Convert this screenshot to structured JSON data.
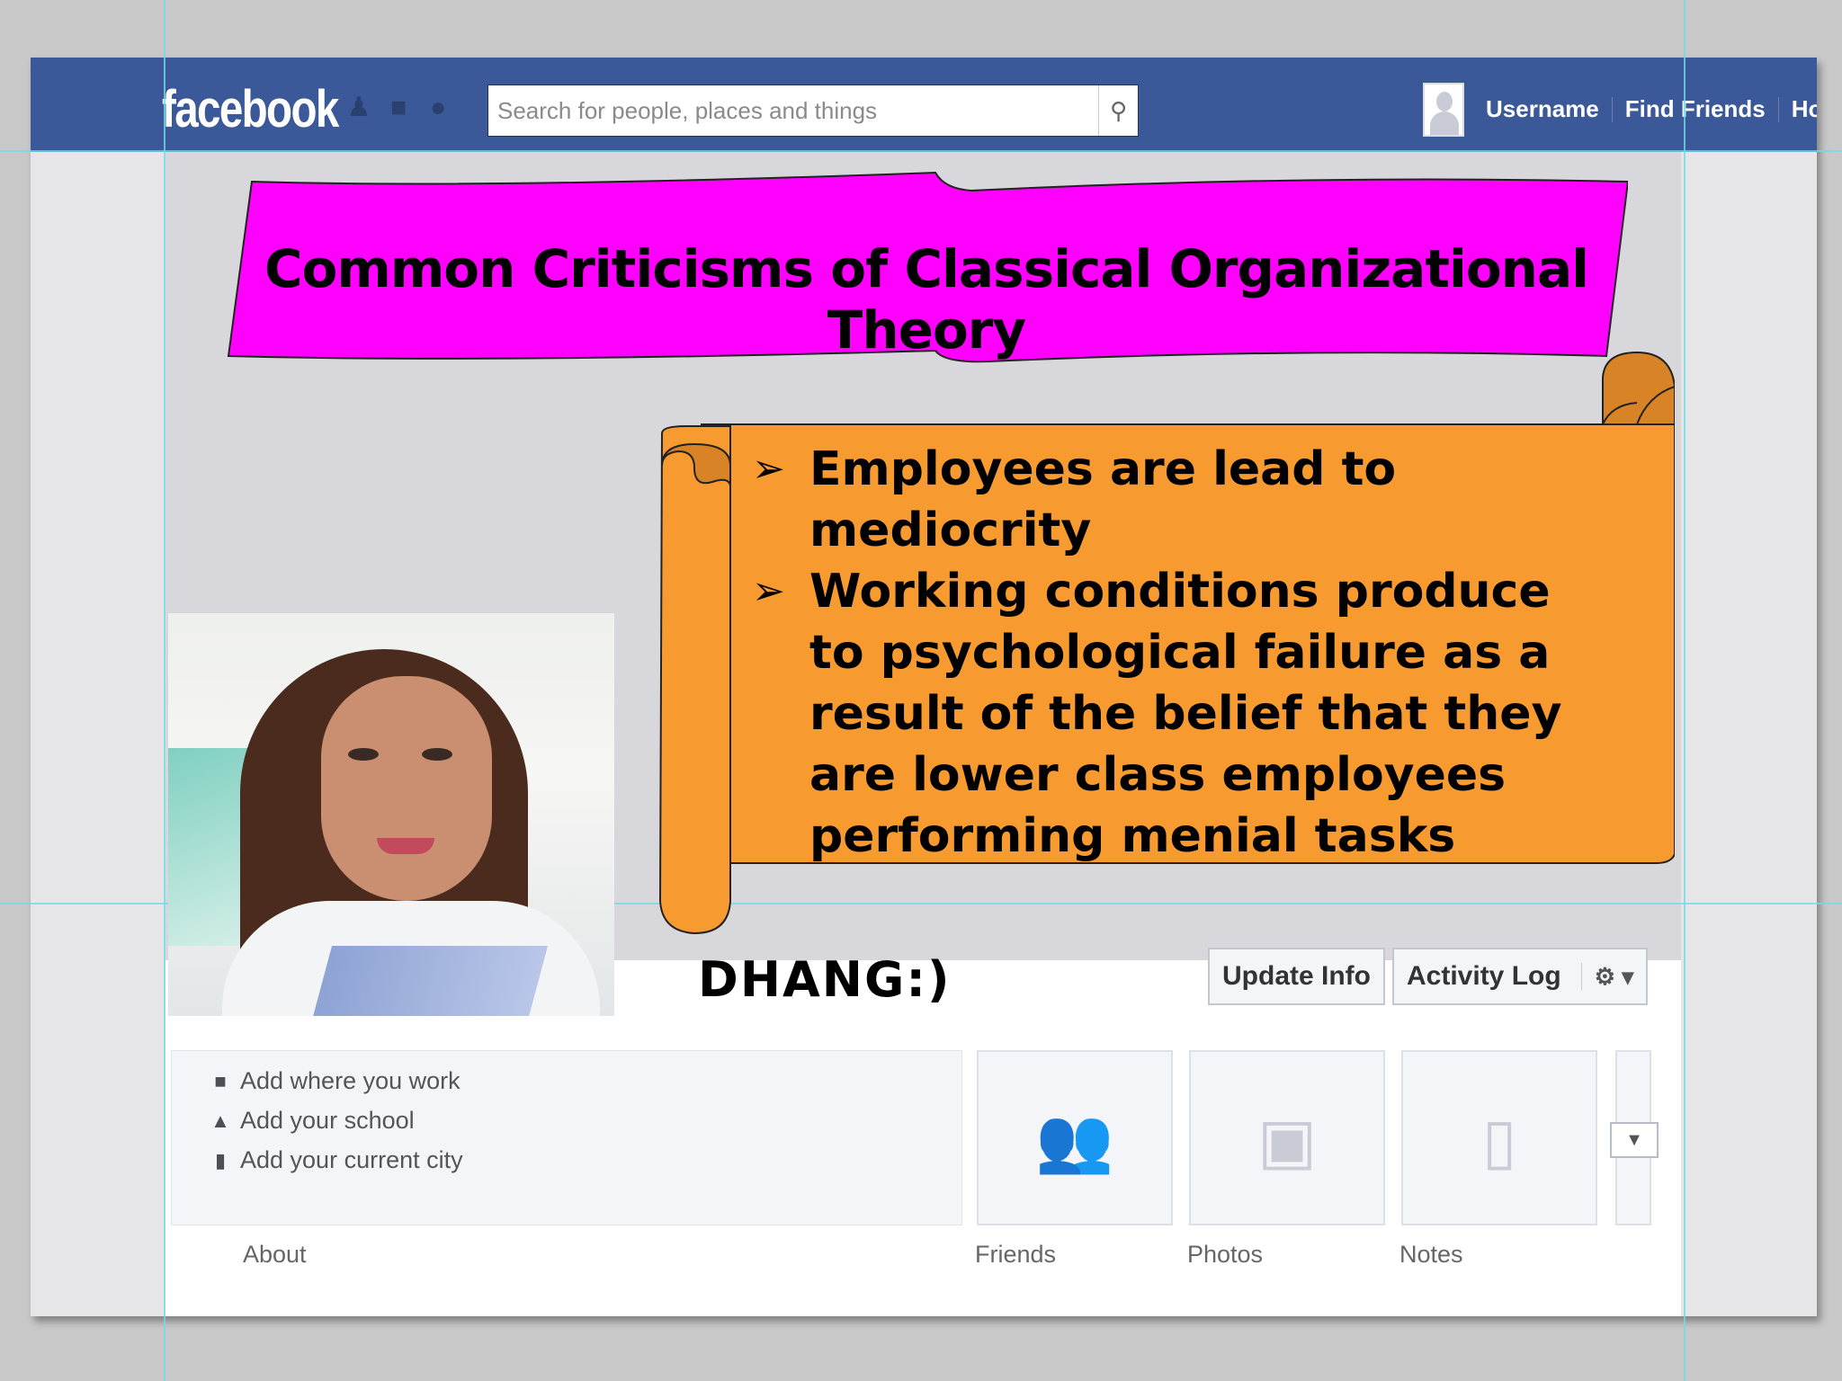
{
  "facebook": {
    "logo": "facebook",
    "search_placeholder": "Search for people, places and things",
    "nav": {
      "username": "Username",
      "find_friends": "Find Friends",
      "home": "Home"
    }
  },
  "slide": {
    "title": "Common Criticisms of Classical Organizational Theory",
    "bullets": [
      "Employees are lead to mediocrity",
      "Working conditions produce to psychological failure as a result of the belief that they are lower class employees performing menial tasks"
    ],
    "bullet_marker": "➢"
  },
  "profile": {
    "name": "DHANG:)",
    "update_info": "Update Info",
    "activity_log": "Activity Log",
    "info_items": [
      "Add where you work",
      "Add your school",
      "Add your current city"
    ],
    "tabs": {
      "about": "About",
      "friends": "Friends",
      "photos": "Photos",
      "notes": "Notes"
    }
  },
  "colors": {
    "facebook_blue": "#3b5998",
    "banner_fill": "#ff00ff",
    "scroll_fill": "#f79a30",
    "guide_line": "#6edce6"
  }
}
